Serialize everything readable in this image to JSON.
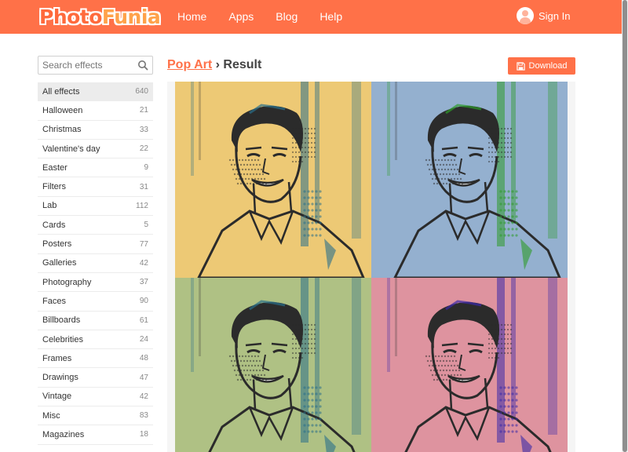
{
  "header": {
    "logo_part1": "Photo",
    "logo_part2": "Funia",
    "nav": [
      "Home",
      "Apps",
      "Blog",
      "Help"
    ],
    "signin_label": "Sign In"
  },
  "search": {
    "placeholder": "Search effects"
  },
  "sidebar": {
    "items": [
      {
        "label": "All effects",
        "count": "640"
      },
      {
        "label": "Halloween",
        "count": "21"
      },
      {
        "label": "Christmas",
        "count": "33"
      },
      {
        "label": "Valentine's day",
        "count": "22"
      },
      {
        "label": "Easter",
        "count": "9"
      },
      {
        "label": "Filters",
        "count": "31"
      },
      {
        "label": "Lab",
        "count": "112"
      },
      {
        "label": "Cards",
        "count": "5"
      },
      {
        "label": "Posters",
        "count": "77"
      },
      {
        "label": "Galleries",
        "count": "42"
      },
      {
        "label": "Photography",
        "count": "37"
      },
      {
        "label": "Faces",
        "count": "90"
      },
      {
        "label": "Billboards",
        "count": "61"
      },
      {
        "label": "Celebrities",
        "count": "24"
      },
      {
        "label": "Frames",
        "count": "48"
      },
      {
        "label": "Drawings",
        "count": "47"
      },
      {
        "label": "Vintage",
        "count": "42"
      },
      {
        "label": "Misc",
        "count": "83"
      },
      {
        "label": "Magazines",
        "count": "18"
      }
    ]
  },
  "main": {
    "breadcrumb_link": "Pop Art",
    "breadcrumb_sep": " › ",
    "breadcrumb_current": "Result",
    "download_label": "Download"
  },
  "colors": {
    "accent": "#ff7148",
    "quad_bg": [
      "#f7d27a",
      "#9bb8d8",
      "#b7c98a",
      "#e89aa6"
    ],
    "quad_ink": [
      "#2a6f8a",
      "#2e9b2a",
      "#2a6f8a",
      "#3b2aa8"
    ]
  }
}
